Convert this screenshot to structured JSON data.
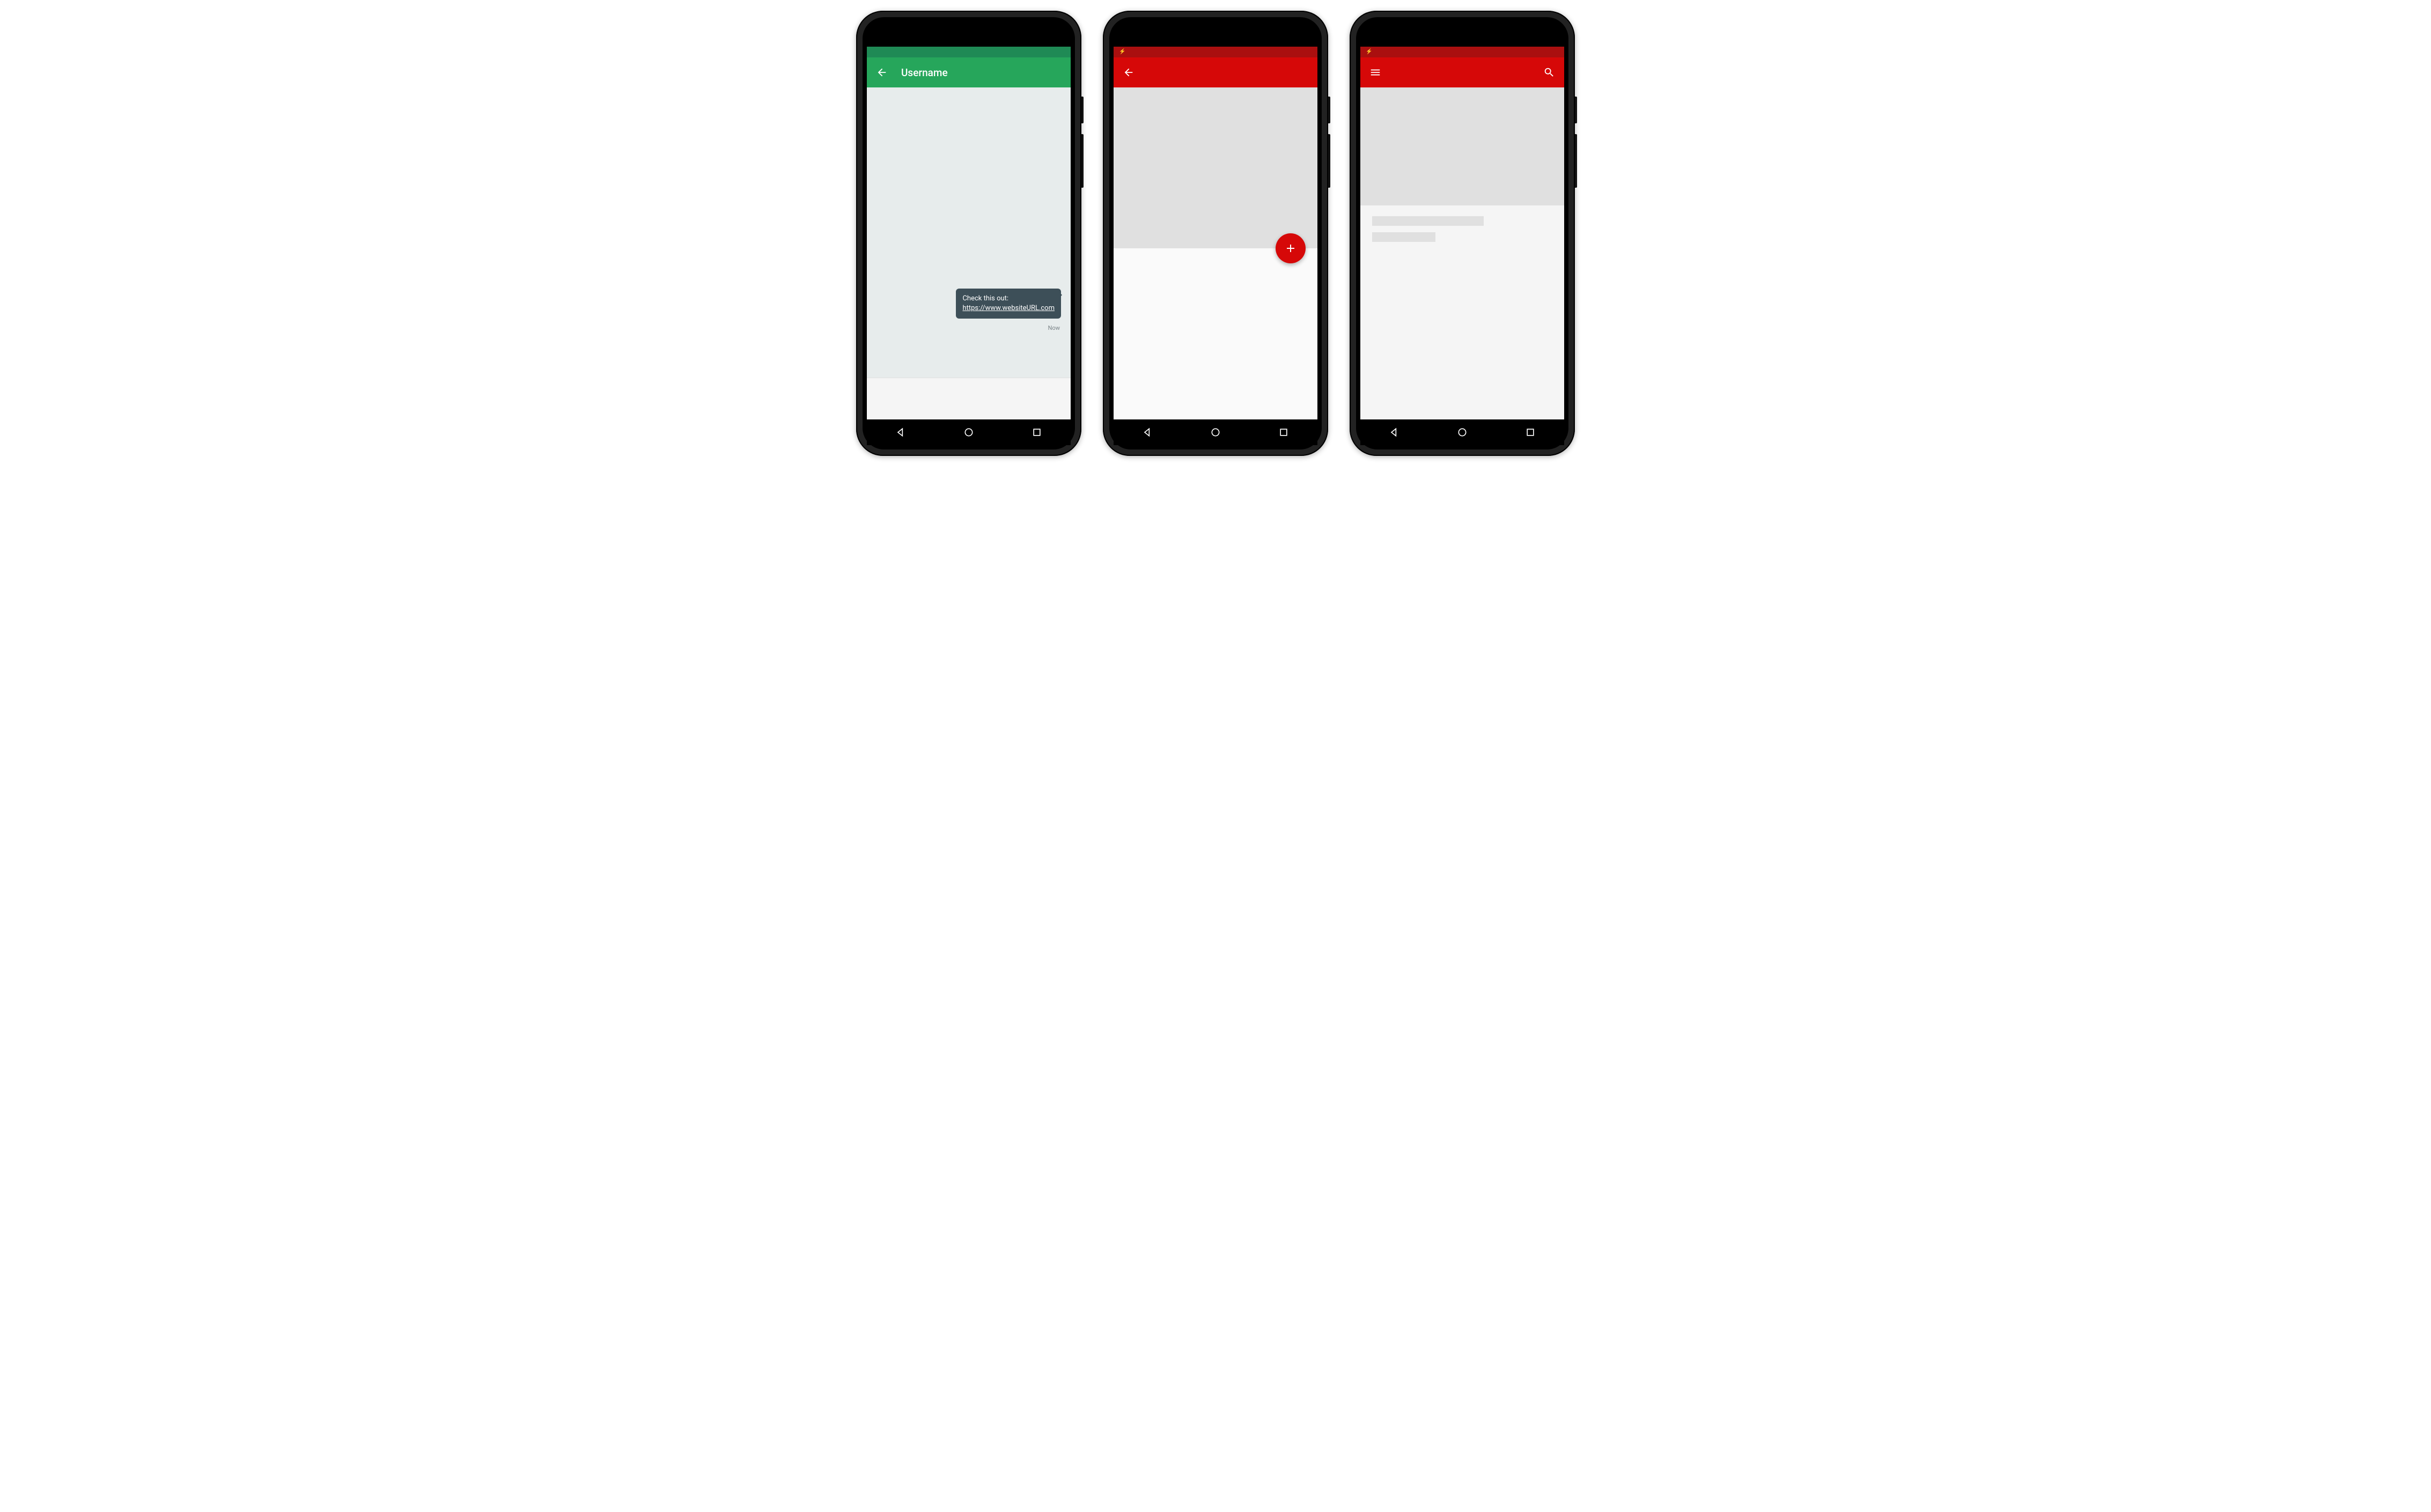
{
  "colors": {
    "green": "#26a65b",
    "greenDark": "#1f8a55",
    "red": "#d60808",
    "redDark": "#aa0f0f"
  },
  "phone1": {
    "appbar": {
      "title": "Username"
    },
    "message": {
      "text_intro": "Check this out:",
      "link": "https://www.websiteURL.com",
      "timestamp": "Now"
    }
  },
  "phone2": {
    "fab_label": "+"
  },
  "phone3": {
    "icons": {
      "menu": "menu",
      "search": "search"
    }
  }
}
